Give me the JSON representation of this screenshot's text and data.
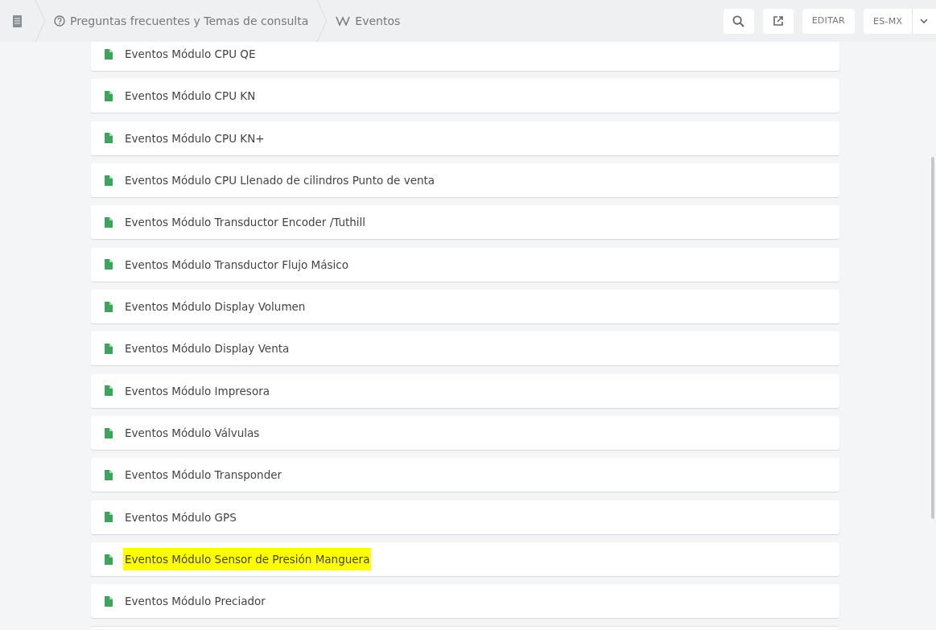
{
  "breadcrumbs": [
    {
      "kind": "home"
    },
    {
      "kind": "faq",
      "label": "Preguntas frecuentes y Temas de consulta"
    },
    {
      "kind": "wiki",
      "label": "Eventos"
    }
  ],
  "toolbar": {
    "edit_button": "EDITAR",
    "language": "ES-MX"
  },
  "pages": [
    {
      "title": "Eventos Módulo CPU QE",
      "highlighted": false
    },
    {
      "title": "Eventos Módulo CPU KN",
      "highlighted": false
    },
    {
      "title": "Eventos Módulo CPU KN+",
      "highlighted": false
    },
    {
      "title": "Eventos Módulo CPU Llenado de cilindros Punto de venta",
      "highlighted": false
    },
    {
      "title": "Eventos Módulo Transductor Encoder /Tuthill",
      "highlighted": false
    },
    {
      "title": "Eventos Módulo Transductor Flujo Másico",
      "highlighted": false
    },
    {
      "title": "Eventos Módulo Display Volumen",
      "highlighted": false
    },
    {
      "title": "Eventos Módulo Display Venta",
      "highlighted": false
    },
    {
      "title": "Eventos Módulo Impresora",
      "highlighted": false
    },
    {
      "title": "Eventos Módulo Válvulas",
      "highlighted": false
    },
    {
      "title": "Eventos Módulo Transponder",
      "highlighted": false
    },
    {
      "title": "Eventos Módulo GPS",
      "highlighted": false
    },
    {
      "title": "Eventos Módulo Sensor de Presión Manguera",
      "highlighted": true
    },
    {
      "title": "Eventos Módulo Preciador",
      "highlighted": false
    }
  ]
}
